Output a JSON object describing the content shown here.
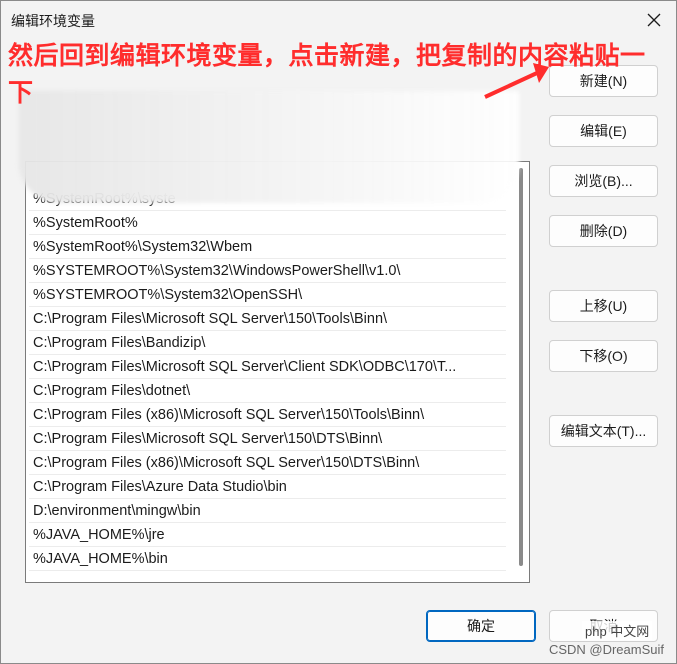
{
  "window": {
    "title": "编辑环境变量"
  },
  "annotation": {
    "text": "然后回到编辑环境变量，点击新建，把复制的内容粘贴一下"
  },
  "path_list": [
    "%SystemRoot%\\syste",
    "%SystemRoot%",
    "%SystemRoot%\\System32\\Wbem",
    "%SYSTEMROOT%\\System32\\WindowsPowerShell\\v1.0\\",
    "%SYSTEMROOT%\\System32\\OpenSSH\\",
    "C:\\Program Files\\Microsoft SQL Server\\150\\Tools\\Binn\\",
    "C:\\Program Files\\Bandizip\\",
    "C:\\Program Files\\Microsoft SQL Server\\Client SDK\\ODBC\\170\\T...",
    "C:\\Program Files\\dotnet\\",
    "C:\\Program Files (x86)\\Microsoft SQL Server\\150\\Tools\\Binn\\",
    "C:\\Program Files\\Microsoft SQL Server\\150\\DTS\\Binn\\",
    "C:\\Program Files (x86)\\Microsoft SQL Server\\150\\DTS\\Binn\\",
    "C:\\Program Files\\Azure Data Studio\\bin",
    "D:\\environment\\mingw\\bin",
    "%JAVA_HOME%\\jre",
    "%JAVA_HOME%\\bin"
  ],
  "buttons": {
    "new": "新建(N)",
    "edit": "编辑(E)",
    "browse": "浏览(B)...",
    "delete": "删除(D)",
    "move_up": "上移(U)",
    "move_down": "下移(O)",
    "edit_text": "编辑文本(T)...",
    "ok": "确定",
    "cancel": "取消"
  },
  "watermark": {
    "site": "php 中文网",
    "credit": "CSDN @DreamSuif"
  },
  "colors": {
    "annotation": "#ff2d2d",
    "primary_border": "#0067c0"
  }
}
